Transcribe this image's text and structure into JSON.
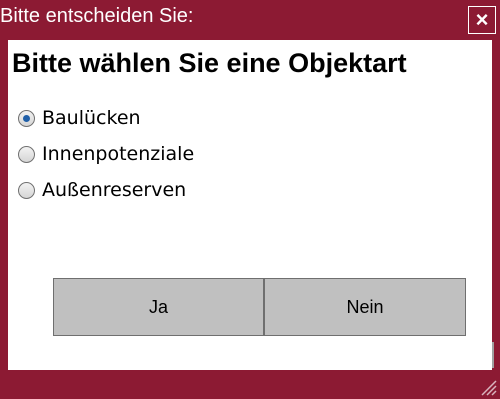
{
  "window": {
    "title": "Bitte entscheiden Sie:",
    "close_label": "×"
  },
  "dialog": {
    "headline": "Bitte wählen Sie eine Objektart",
    "options": [
      {
        "label": "Baulücken",
        "checked": true
      },
      {
        "label": "Innenpotenziale",
        "checked": false
      },
      {
        "label": "Außenreserven",
        "checked": false
      }
    ],
    "buttons": {
      "yes_label": "Ja",
      "no_label": "Nein"
    }
  },
  "colors": {
    "accent": "#8c1a33",
    "button_face": "#c0c0c0",
    "radio_dot": "#1f5fa8"
  },
  "icons": {
    "close": "close-icon",
    "resize": "resize-grip-icon"
  }
}
